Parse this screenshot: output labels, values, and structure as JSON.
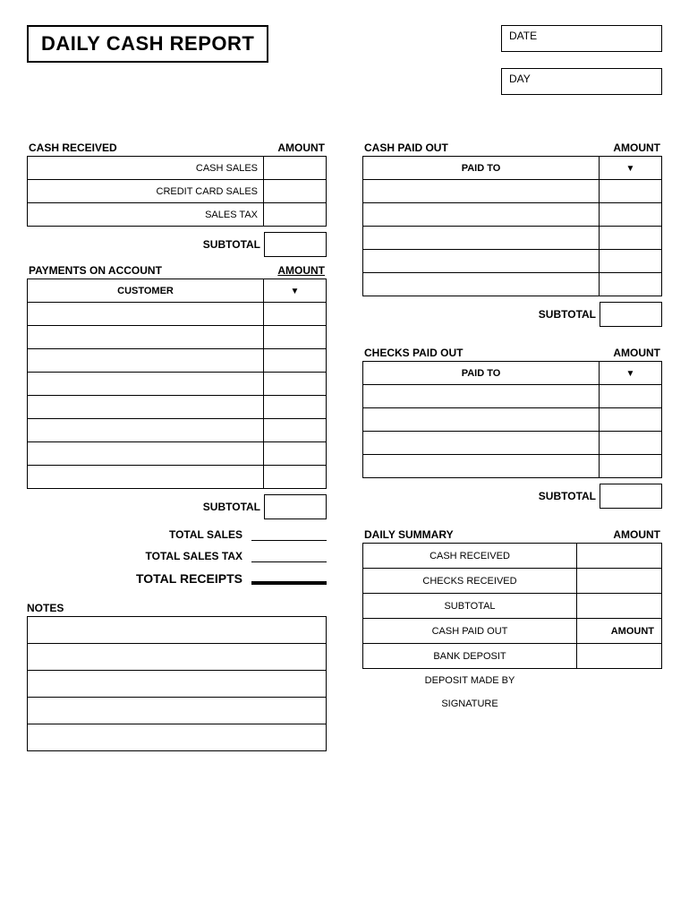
{
  "title": "DAILY CASH REPORT",
  "date_label": "DATE",
  "day_label": "DAY",
  "left": {
    "cash_received": {
      "header": "CASH RECEIVED",
      "amount_header": "AMOUNT",
      "rows": [
        "CASH SALES",
        "CREDIT CARD SALES",
        "SALES TAX"
      ],
      "subtotal": "SUBTOTAL"
    },
    "payments": {
      "header": "PAYMENTS ON ACCOUNT",
      "amount_header": "AMOUNT",
      "customer": "CUSTOMER",
      "subtotal": "SUBTOTAL"
    },
    "totals": {
      "total_sales": "TOTAL SALES",
      "total_sales_tax": "TOTAL SALES TAX",
      "total_receipts": "TOTAL RECEIPTS"
    },
    "notes": "NOTES"
  },
  "right": {
    "cash_paid": {
      "header": "CASH PAID OUT",
      "amount_header": "AMOUNT",
      "paid_to": "PAID TO",
      "subtotal": "SUBTOTAL"
    },
    "checks_paid": {
      "header": "CHECKS PAID OUT",
      "amount_header": "AMOUNT",
      "paid_to": "PAID TO",
      "subtotal": "SUBTOTAL"
    },
    "summary": {
      "header": "DAILY SUMMARY",
      "amount_header": "AMOUNT",
      "rows": {
        "cash_received": "CASH RECEIVED",
        "checks_received": "CHECKS RECEIVED",
        "subtotal": "SUBTOTAL",
        "cash_paid_out": "CASH PAID OUT",
        "amount_label": "AMOUNT",
        "bank_deposit": "BANK DEPOSIT",
        "deposit_made_by": "DEPOSIT MADE BY",
        "signature": "SIGNATURE"
      }
    }
  }
}
